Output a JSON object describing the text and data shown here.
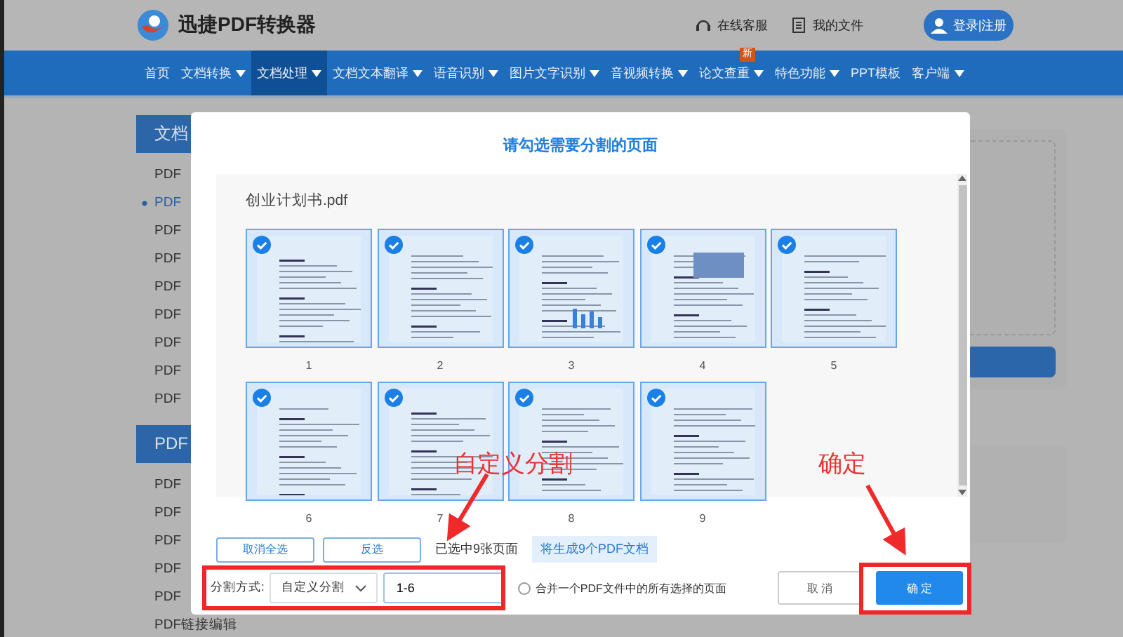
{
  "header": {
    "logo_text": "迅捷PDF转换器",
    "links": [
      {
        "kind": "support",
        "label": "在线客服"
      },
      {
        "kind": "files",
        "label": "我的文件"
      }
    ],
    "login": "登录|注册"
  },
  "nav": [
    {
      "label": "首页",
      "dropdown": false,
      "selected": false
    },
    {
      "label": "文档转换",
      "dropdown": true,
      "selected": false
    },
    {
      "label": "文档处理",
      "dropdown": true,
      "selected": true
    },
    {
      "label": "文档文本翻译",
      "dropdown": true,
      "selected": false
    },
    {
      "label": "语音识别",
      "dropdown": true,
      "selected": false
    },
    {
      "label": "图片文字识别",
      "dropdown": true,
      "selected": false
    },
    {
      "label": "音视频转换",
      "dropdown": true,
      "selected": false
    },
    {
      "label": "论文查重",
      "dropdown": true,
      "selected": false,
      "badge": "新"
    },
    {
      "label": "特色功能",
      "dropdown": true,
      "selected": false
    },
    {
      "label": "PPT模板",
      "dropdown": false,
      "selected": false
    },
    {
      "label": "客户端",
      "dropdown": true,
      "selected": false
    }
  ],
  "sidebar": [
    {
      "title": "文档",
      "items": [
        {
          "label": "PDF",
          "selected": false
        },
        {
          "label": "PDF",
          "selected": true
        },
        {
          "label": "PDF",
          "selected": false
        },
        {
          "label": "PDF",
          "selected": false
        },
        {
          "label": "PDF",
          "selected": false
        },
        {
          "label": "PDF",
          "selected": false
        },
        {
          "label": "PDF",
          "selected": false
        },
        {
          "label": "PDF",
          "selected": false
        },
        {
          "label": "PDF",
          "selected": false
        }
      ]
    },
    {
      "title": "PDF",
      "items": [
        {
          "label": "PDF",
          "selected": false
        },
        {
          "label": "PDF",
          "selected": false
        },
        {
          "label": "PDF",
          "selected": false
        },
        {
          "label": "PDF",
          "selected": false
        },
        {
          "label": "PDF",
          "selected": false
        },
        {
          "label": "PDF链接编辑",
          "selected": false
        }
      ]
    }
  ],
  "dialog": {
    "title": "请勾选需要分割的页面",
    "file_name": "创业计划书.pdf",
    "pages": [
      {
        "label": "1",
        "checked": true
      },
      {
        "label": "2",
        "checked": true
      },
      {
        "label": "3",
        "checked": true
      },
      {
        "label": "4",
        "checked": true
      },
      {
        "label": "5",
        "checked": true
      },
      {
        "label": "6",
        "checked": true
      },
      {
        "label": "7",
        "checked": true
      },
      {
        "label": "8",
        "checked": true
      },
      {
        "label": "9",
        "checked": true
      }
    ],
    "select_buttons": [
      "取消全选",
      "反选"
    ],
    "selected_count": "已选中9张页面",
    "hint": "将生成9个PDF文档",
    "split_label": "分割方式:",
    "split_mode": "自定义分割",
    "range": "1-6",
    "merge": {
      "label": "合并一个PDF文件中的所有选择的页面",
      "checked": false
    },
    "cancel": "取 消",
    "confirm": "确 定"
  },
  "annotations": [
    {
      "kind": "custom",
      "text": "自定义分割"
    },
    {
      "kind": "confirm",
      "text": "确定"
    }
  ]
}
